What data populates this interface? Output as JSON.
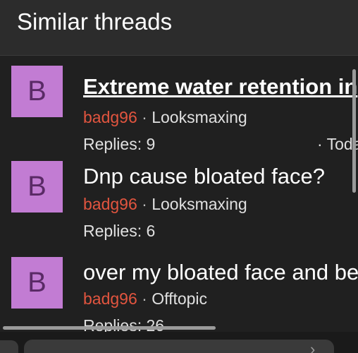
{
  "header": {
    "title": "Similar threads"
  },
  "threads": [
    {
      "avatar_letter": "B",
      "title": "Extreme water retention in",
      "author": "badg96",
      "separator": "·",
      "forum": "Looksmaxing",
      "replies": "Replies: 9",
      "date": "· Toda"
    },
    {
      "avatar_letter": "B",
      "title": "Dnp cause bloated face?",
      "author": "badg96",
      "separator": "·",
      "forum": "Looksmaxing",
      "replies": "Replies: 6"
    },
    {
      "avatar_letter": "B",
      "title": "over my bloated face and be",
      "author": "badg96",
      "separator": "·",
      "forum": "Offtopic",
      "replies": "Replies: 26"
    }
  ],
  "bottom_bar": {
    "chevron_icon": "chevron-right-icon"
  },
  "colors": {
    "avatar_bg": "#c27cd3",
    "username": "#e2553f",
    "background": "#202020",
    "header_bg": "#2c2c2c"
  }
}
